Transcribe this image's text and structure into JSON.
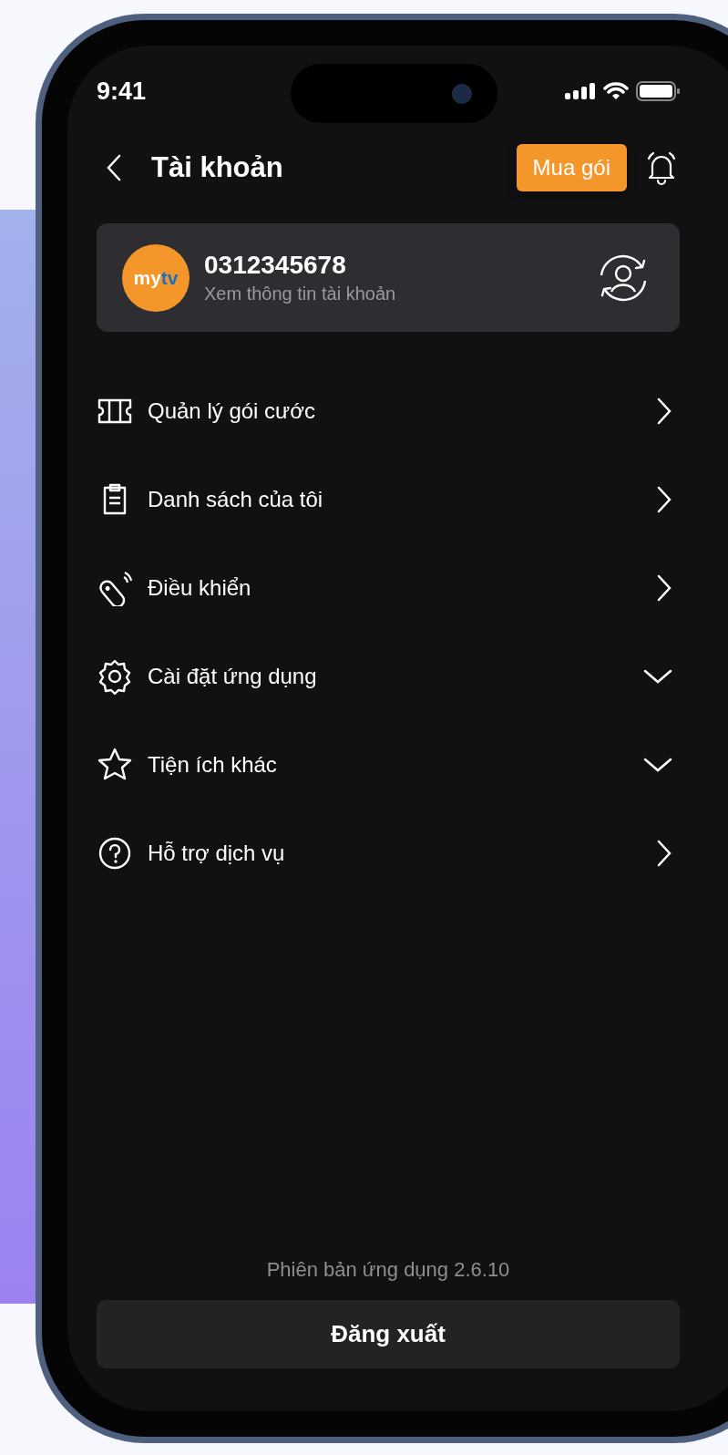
{
  "status_bar": {
    "time": "9:41"
  },
  "header": {
    "title": "Tài khoản",
    "buy_button": "Mua gói"
  },
  "account": {
    "logo": [
      "my",
      "tv"
    ],
    "phone": "0312345678",
    "subtitle": "Xem thông tin tài khoản"
  },
  "menu": [
    {
      "label": "Quản lý gói cước",
      "kind": "link"
    },
    {
      "label": "Danh sách của tôi",
      "kind": "link"
    },
    {
      "label": "Điều khiển",
      "kind": "link"
    },
    {
      "label": "Cài đặt ứng dụng",
      "kind": "expandable"
    },
    {
      "label": "Tiện ích khác",
      "kind": "expandable"
    },
    {
      "label": "Hỗ trợ dịch vụ",
      "kind": "link"
    }
  ],
  "version": "Phiên bản ứng dụng 2.6.10",
  "logout_button": "Đăng xuất"
}
